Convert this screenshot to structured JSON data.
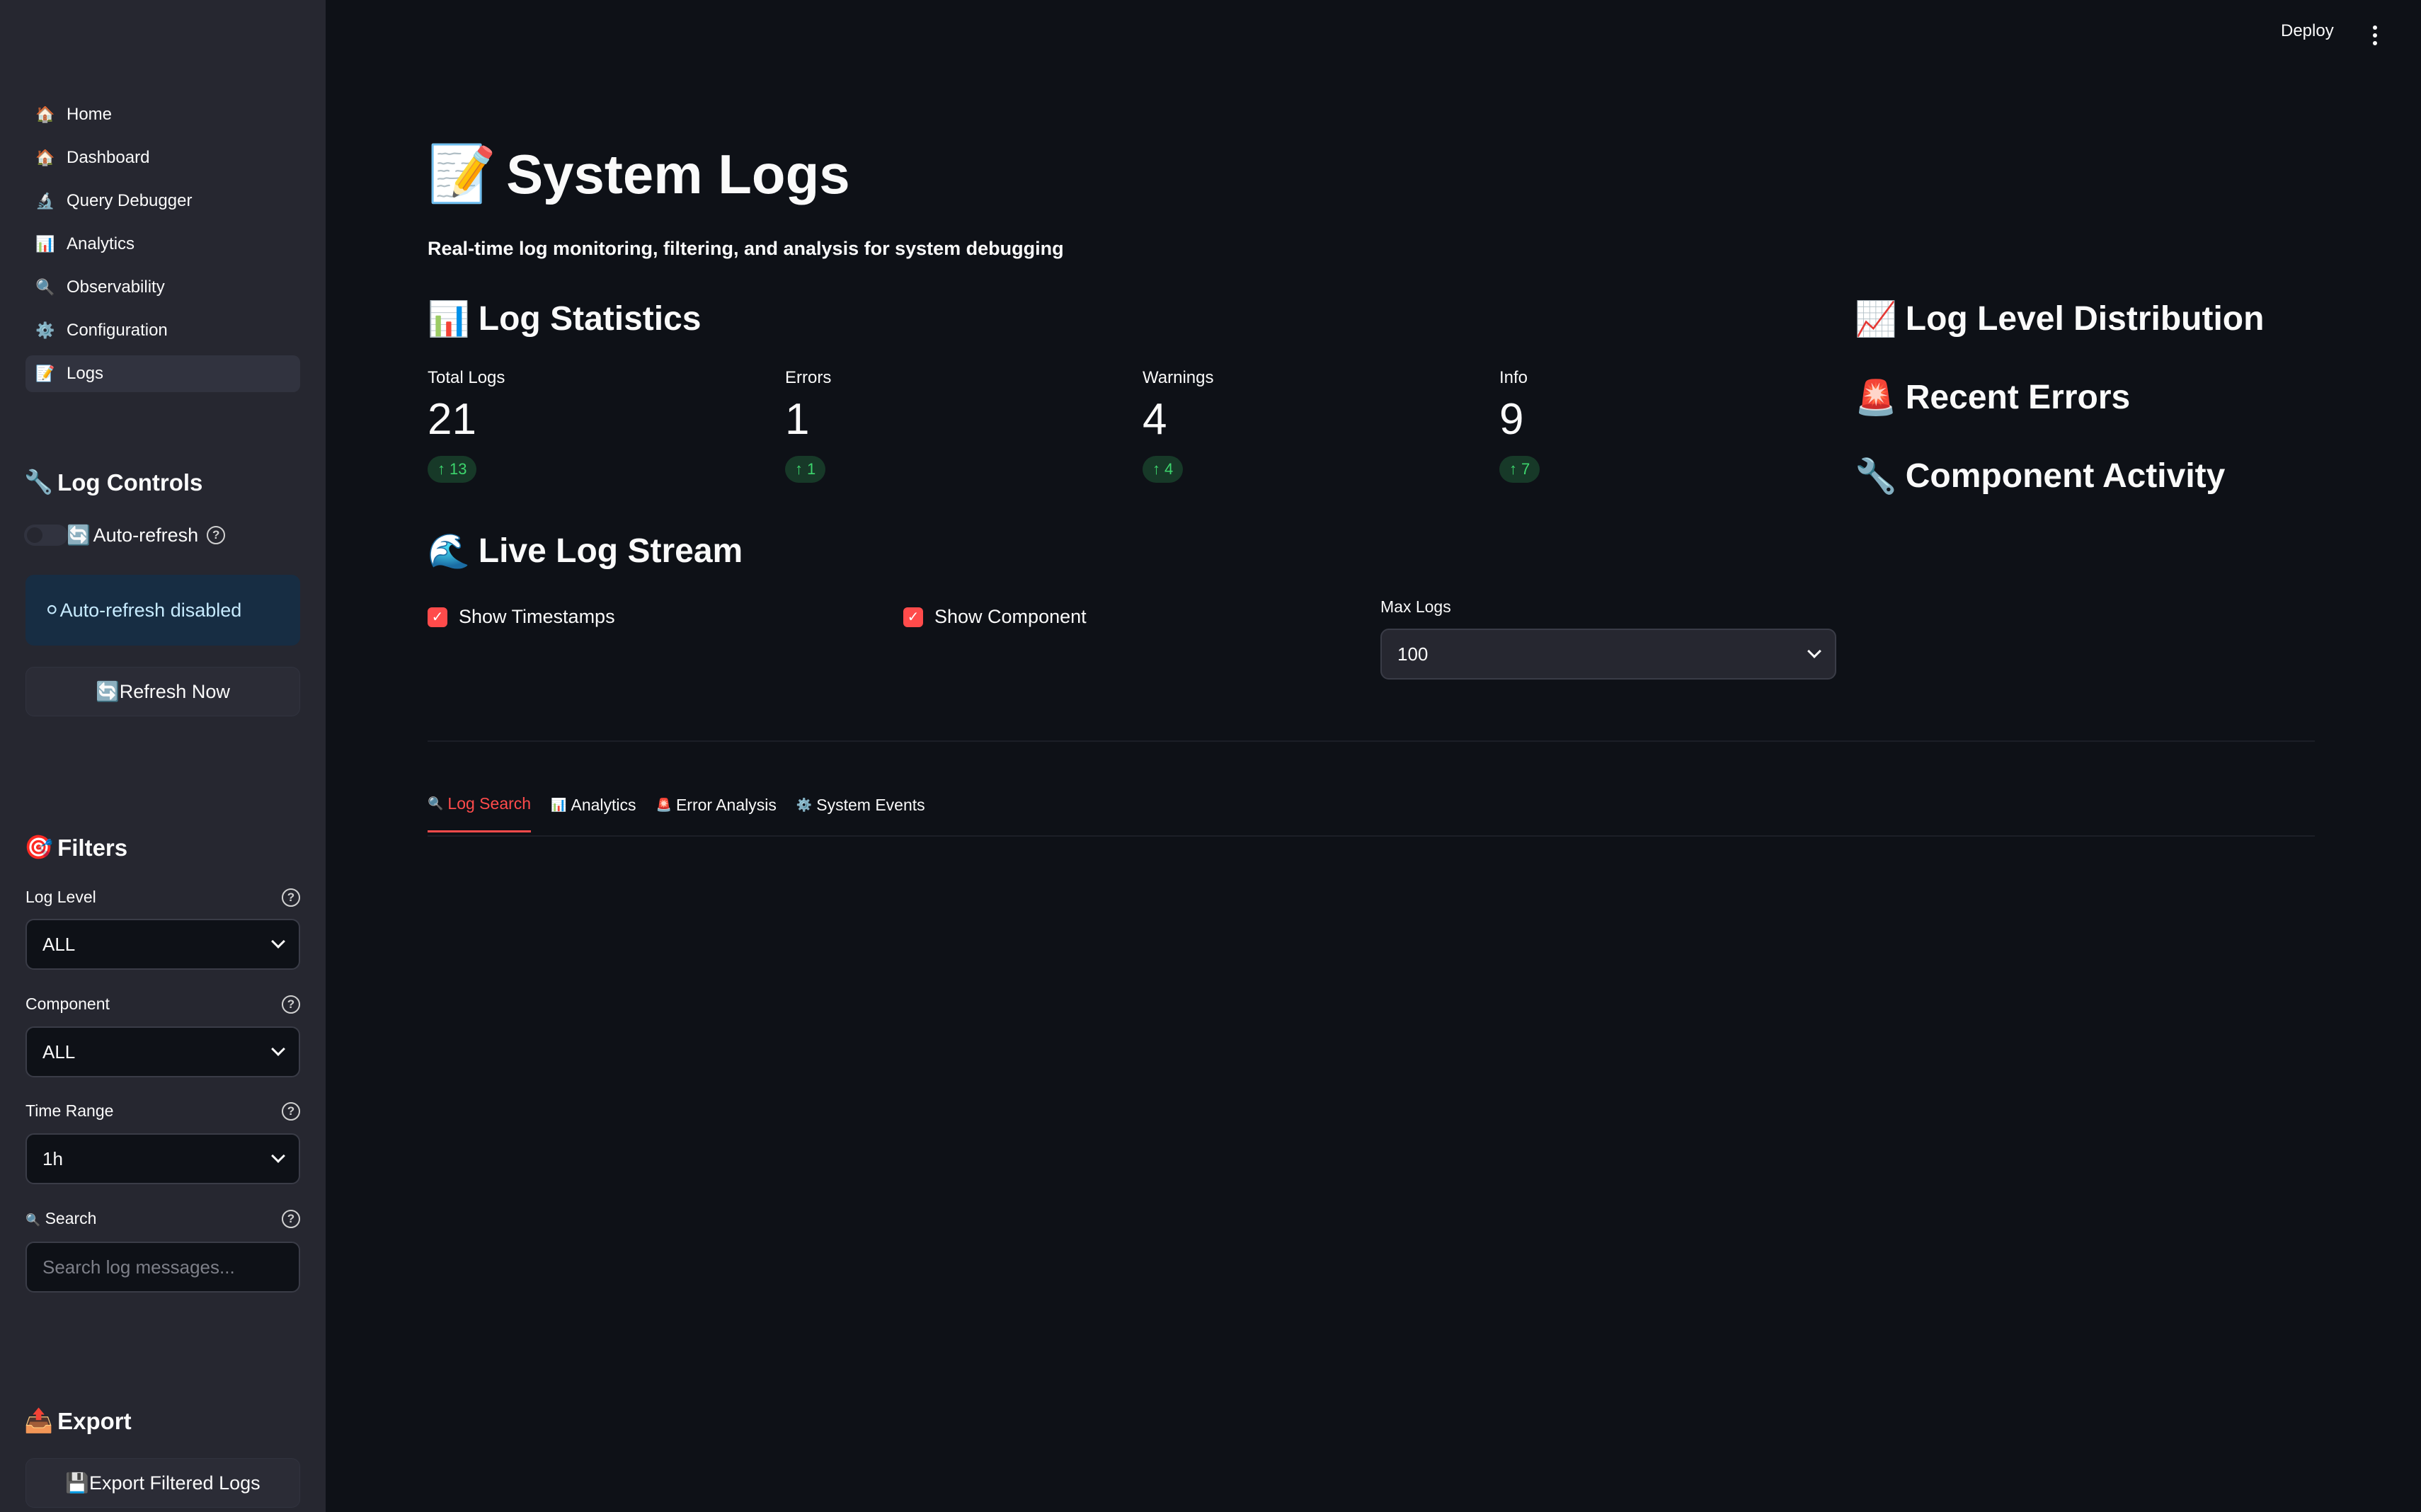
{
  "header": {
    "deploy_label": "Deploy",
    "menu_icon": "kebab-menu-icon"
  },
  "sidebar": {
    "nav": [
      {
        "icon": "🏠",
        "icon_name": "home-icon",
        "label": "Home"
      },
      {
        "icon": "🏠",
        "icon_name": "home-icon",
        "label": "Dashboard"
      },
      {
        "icon": "🔬",
        "icon_name": "microscope-icon",
        "label": "Query Debugger"
      },
      {
        "icon": "📊",
        "icon_name": "bar-chart-icon",
        "label": "Analytics"
      },
      {
        "icon": "🔍",
        "icon_name": "magnifier-icon",
        "label": "Observability"
      },
      {
        "icon": "⚙️",
        "icon_name": "gear-icon",
        "label": "Configuration"
      },
      {
        "icon": "📝",
        "icon_name": "memo-icon",
        "label": "Logs",
        "active": true
      }
    ],
    "log_controls": {
      "icon": "🔧",
      "title": "Log Controls",
      "auto_refresh_icon": "🔄",
      "auto_refresh_label": "Auto-refresh",
      "auto_refresh_enabled": false,
      "status_icon": "⚪",
      "status_text": "Auto-refresh disabled",
      "refresh_icon": "🔄",
      "refresh_label": "Refresh Now"
    },
    "filters": {
      "icon": "🎯",
      "title": "Filters",
      "log_level_label": "Log Level",
      "log_level_value": "ALL",
      "component_label": "Component",
      "component_value": "ALL",
      "time_range_label": "Time Range",
      "time_range_value": "1h",
      "search_icon": "🔍",
      "search_label": "Search",
      "search_placeholder": "Search log messages..."
    },
    "export": {
      "icon": "📤",
      "title": "Export",
      "button_icon": "💾",
      "button_label": "Export Filtered Logs"
    }
  },
  "main": {
    "title_icon": "📝",
    "title": "System Logs",
    "subtitle": "Real-time log monitoring, filtering, and analysis for system debugging",
    "stats_icon": "📊",
    "stats_title": "Log Statistics",
    "metrics": [
      {
        "label": "Total Logs",
        "value": "21",
        "delta": "13"
      },
      {
        "label": "Errors",
        "value": "1",
        "delta": "1"
      },
      {
        "label": "Warnings",
        "value": "4",
        "delta": "4"
      },
      {
        "label": "Info",
        "value": "9",
        "delta": "7"
      }
    ],
    "right_sections": [
      {
        "icon": "📈",
        "title": "Log Level Distribution"
      },
      {
        "icon": "🚨",
        "title": "Recent Errors"
      },
      {
        "icon": "🔧",
        "title": "Component Activity"
      }
    ],
    "stream_icon": "🌊",
    "stream_title": "Live Log Stream",
    "show_timestamps_label": "Show Timestamps",
    "show_timestamps_checked": true,
    "show_component_label": "Show Component",
    "show_component_checked": true,
    "max_logs_label": "Max Logs",
    "max_logs_value": "100",
    "tabs": [
      {
        "icon": "🔍",
        "label": "Log Search",
        "active": true
      },
      {
        "icon": "📊",
        "label": "Analytics"
      },
      {
        "icon": "🚨",
        "label": "Error Analysis"
      },
      {
        "icon": "⚙️",
        "label": "System Events"
      }
    ]
  },
  "colors": {
    "background": "#0e1117",
    "sidebar": "#262730",
    "accent": "#ff4b4b",
    "delta_positive": "#3dd56d",
    "info_box": "#172d43"
  }
}
